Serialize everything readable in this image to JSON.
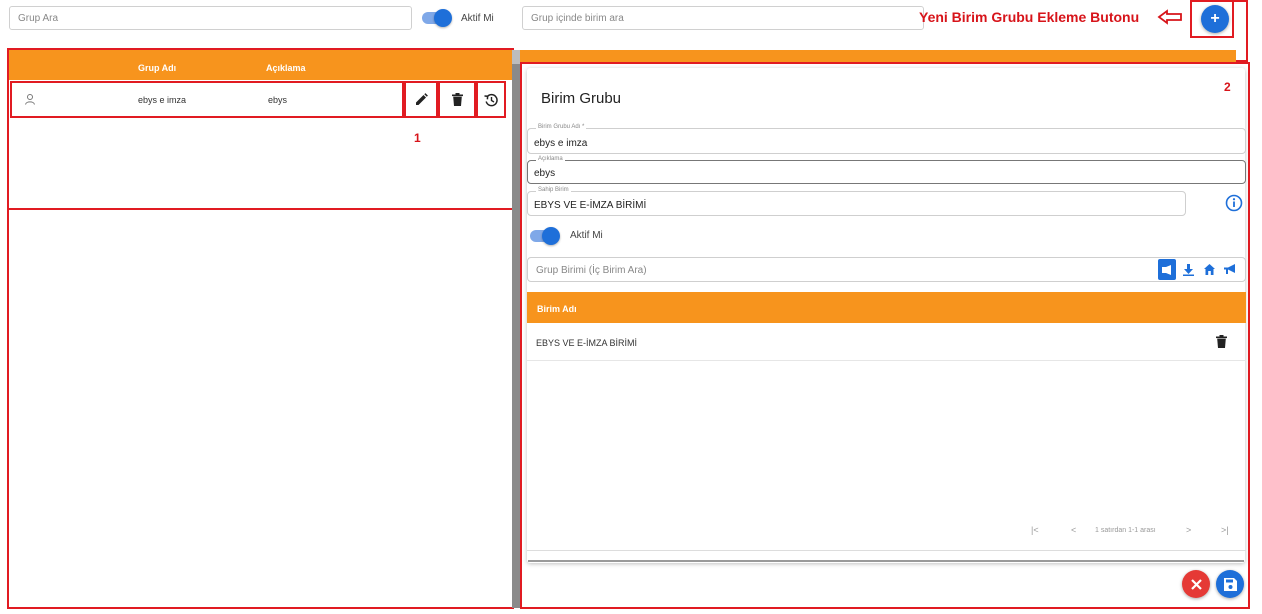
{
  "top": {
    "group_search_placeholder": "Grup Ara",
    "active_label": "Aktif Mi",
    "unit_search_placeholder": "Grup içinde birim ara",
    "annotation_title": "Yeni Birim Grubu Ekleme Butonu",
    "add_icon": "plus-icon"
  },
  "left": {
    "columns": [
      "Grup Adı",
      "Açıklama"
    ],
    "rows": [
      {
        "name": "ebys e imza",
        "description": "ebys"
      }
    ],
    "annotation_number": "1"
  },
  "right": {
    "title": "Birim Grubu",
    "annotation_number": "2",
    "fields": {
      "group_name_label": "Birim Grubu Adı *",
      "group_name_value": "ebys e imza",
      "description_label": "Açıklama",
      "description_value": "ebys",
      "owner_label": "Sahip Birim",
      "owner_value": "EBYS VE E-İMZA BİRİMİ"
    },
    "active_label": "Aktif Mi",
    "unit_search_placeholder": "Grup Birimi (İç Birim Ara)",
    "table_header": "Birim Adı",
    "table_rows": [
      {
        "name": "EBYS VE E-İMZA BİRİMİ"
      }
    ],
    "pager_text": "1 satırdan 1-1 arası"
  },
  "colors": {
    "accent_orange": "#f7941d",
    "primary_blue": "#1e6fd9",
    "annotation_red": "#e11b22",
    "cancel_red": "#e53935"
  }
}
